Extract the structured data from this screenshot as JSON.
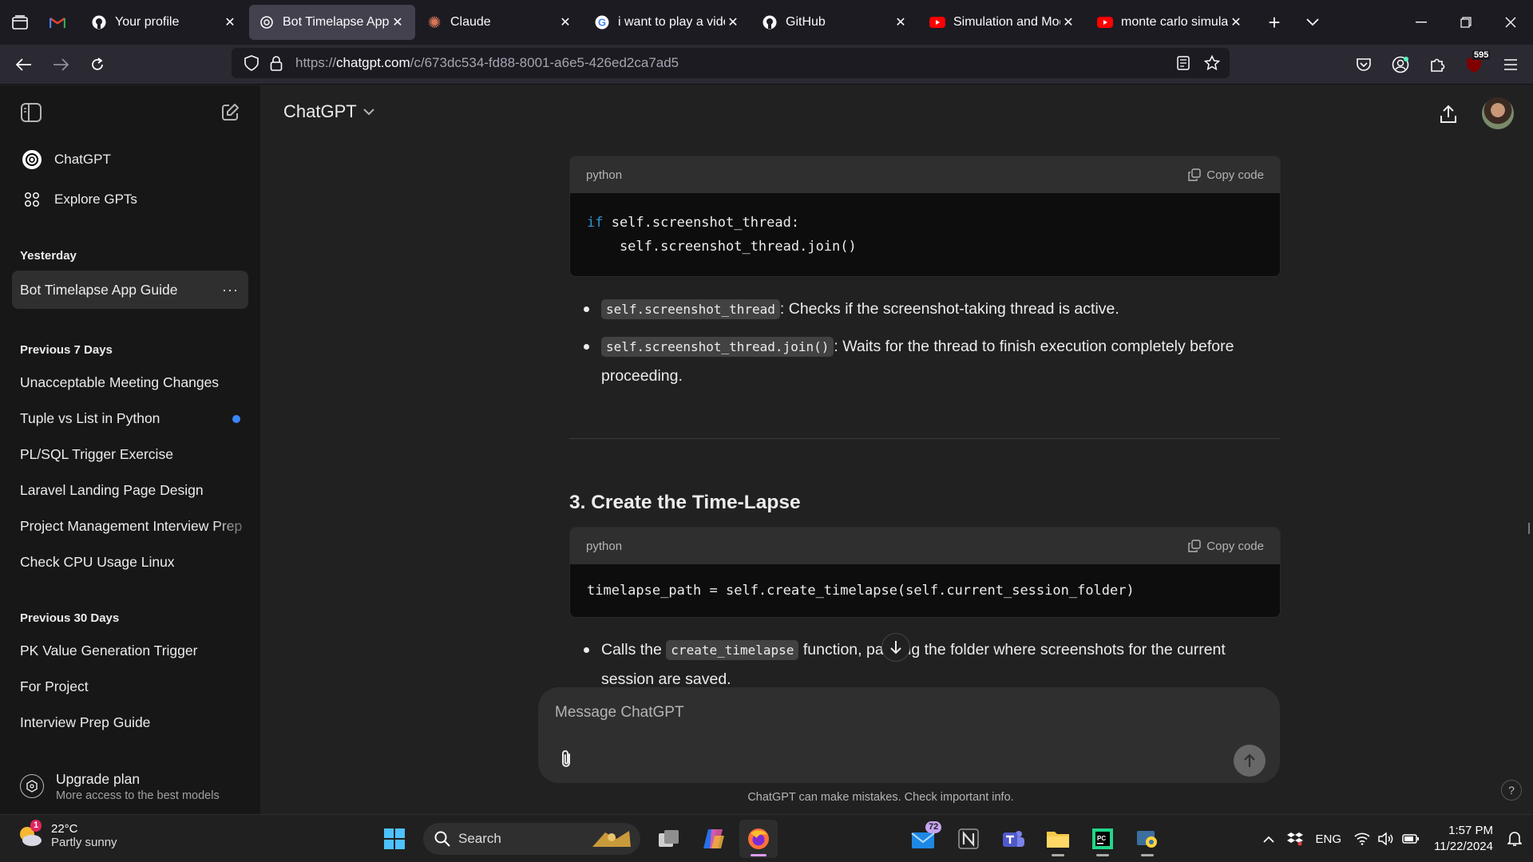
{
  "browser": {
    "tabs": [
      {
        "title": "",
        "icon": "gmail-icon",
        "x": ""
      },
      {
        "title": "Your profile",
        "icon": "github-icon",
        "x": "✕"
      },
      {
        "title": "Bot Timelapse App Gu",
        "icon": "chatgpt-icon",
        "x": "✕"
      },
      {
        "title": "Claude",
        "icon": "claude-icon",
        "x": "✕"
      },
      {
        "title": "i want to play a video",
        "icon": "google-icon",
        "x": "✕"
      },
      {
        "title": "GitHub",
        "icon": "github-icon",
        "x": "✕"
      },
      {
        "title": "Simulation and Mod",
        "icon": "youtube-icon",
        "x": "✕"
      },
      {
        "title": "monte carlo simulati",
        "icon": "youtube-icon",
        "x": "✕"
      }
    ],
    "new_tab": "+",
    "url_pre": "https://",
    "url_host": "chatgpt.com",
    "url_path": "/c/673dc534-fd88-8001-a6e5-426ed2ca7ad5",
    "extension_badge": "595"
  },
  "sidebar": {
    "nav": [
      {
        "label": "ChatGPT",
        "icon": "chatgpt-icon"
      },
      {
        "label": "Explore GPTs",
        "icon": "grid-icon"
      }
    ],
    "sections": [
      {
        "heading": "Yesterday",
        "items": [
          "Bot Timelapse App Guide"
        ]
      },
      {
        "heading": "Previous 7 Days",
        "items": [
          "Unacceptable Meeting Changes",
          "Tuple vs List in Python",
          "PL/SQL Trigger Exercise",
          "Laravel Landing Page Design",
          "Project Management Interview Prep",
          "Check CPU Usage Linux"
        ]
      },
      {
        "heading": "Previous 30 Days",
        "items": [
          "PK Value Generation Trigger",
          "For Project",
          "Interview Prep Guide"
        ]
      }
    ],
    "more": "···",
    "upgrade_title": "Upgrade plan",
    "upgrade_sub": "More access to the best models"
  },
  "main": {
    "model": "ChatGPT",
    "code1": {
      "lang": "python",
      "copy": "Copy code",
      "kw": "if",
      "line1_rest": " self.screenshot_thread:",
      "line2": "    self.screenshot_thread.join()"
    },
    "bullet1_code": "self.screenshot_thread",
    "bullet1_text": ": Checks if the screenshot-taking thread is active.",
    "bullet2_code": "self.screenshot_thread.join()",
    "bullet2_text": ": Waits for the thread to finish execution completely before proceeding.",
    "heading": "3. Create the Time-Lapse",
    "code2": {
      "lang": "python",
      "copy": "Copy code",
      "line1": "timelapse_path = self.create_timelapse(self.current_session_folder)"
    },
    "bullet3_pre": "Calls the ",
    "bullet3_code": "create_timelapse",
    "bullet3_text": " function, passing the folder where screenshots for the current session are saved.",
    "composer_placeholder": "Message ChatGPT",
    "disclaimer": "ChatGPT can make mistakes. Check important info.",
    "help": "?"
  },
  "taskbar": {
    "weather_temp": "22°C",
    "weather_desc": "Partly sunny",
    "weather_badge": "1",
    "search_label": "Search",
    "mail_badge": "72",
    "lang": "ENG",
    "time": "1:57 PM",
    "date": "11/22/2024"
  },
  "colors": {
    "accent_blue": "#3a86ff",
    "code_keyword": "#2e95d3",
    "sidebar_bg": "#171717",
    "main_bg": "#212121"
  }
}
